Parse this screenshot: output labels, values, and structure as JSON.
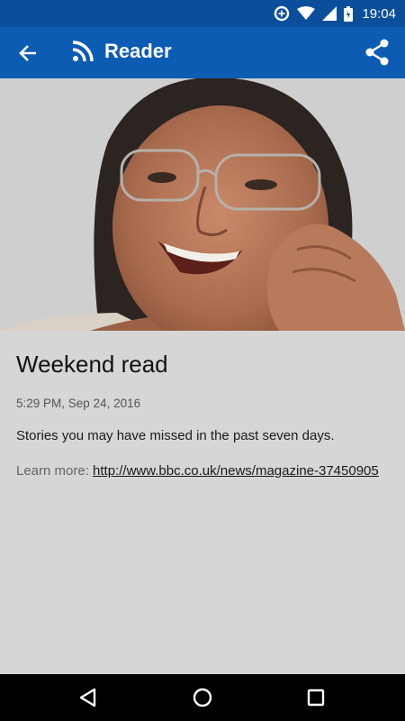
{
  "status_bar": {
    "time": "19:04",
    "icons": [
      "data-saver-icon",
      "wifi-icon",
      "signal-icon",
      "battery-icon"
    ]
  },
  "app_bar": {
    "title": "Reader",
    "back_icon": "arrow-back-icon",
    "rss_icon": "rss-icon",
    "share_icon": "share-icon",
    "color": "#0d5cb3",
    "status_color": "#0b4f9c"
  },
  "article": {
    "title": "Weekend read",
    "date": "5:29 PM, Sep 24, 2016",
    "summary": "Stories you may have missed in the past seven days.",
    "learn_more_label": "Learn more: ",
    "link": "http://www.bbc.co.uk/news/magazine-37450905"
  },
  "nav_bar": {
    "icons": [
      "back-triangle-icon",
      "home-circle-icon",
      "recents-square-icon"
    ]
  }
}
